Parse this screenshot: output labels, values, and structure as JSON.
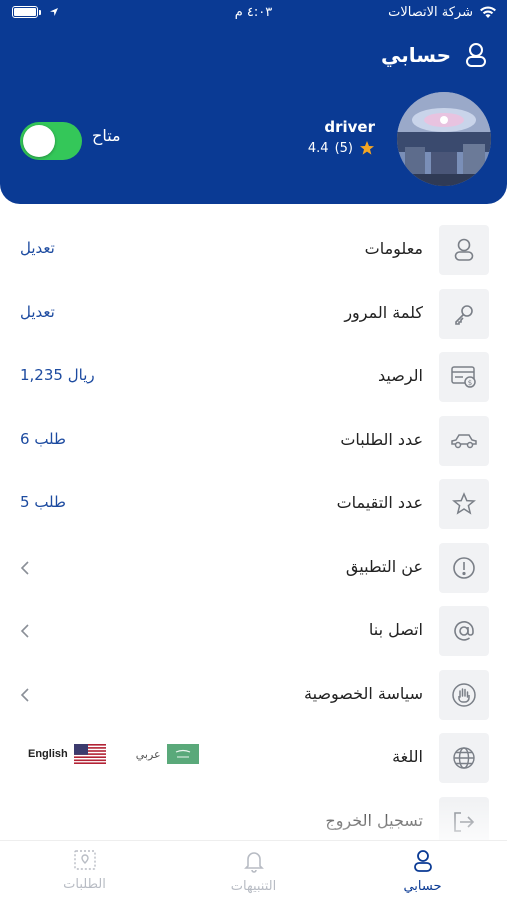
{
  "status_bar": {
    "carrier": "شركة الاتصالات",
    "time": "٤:٠٣ م"
  },
  "header": {
    "title": "حسابي",
    "driver_name": "driver",
    "rating": "4.4",
    "rating_count": "(5)",
    "availability_label": "متاح",
    "availability_on": true,
    "colors": {
      "brand": "#0a3a94",
      "toggle_on": "#34c759",
      "star": "#f5a623"
    }
  },
  "menu": {
    "info": {
      "label": "معلومات",
      "action": "تعديل",
      "icon": "user-icon"
    },
    "password": {
      "label": "كلمة المرور",
      "action": "تعديل",
      "icon": "key-icon"
    },
    "balance": {
      "label": "الرصيد",
      "value": "1,235 ريال",
      "icon": "wallet-icon"
    },
    "orders": {
      "label": "عدد الطلبات",
      "value": "6 طلب",
      "icon": "car-icon"
    },
    "ratings": {
      "label": "عدد التقيمات",
      "value": "5 طلب",
      "icon": "star-icon"
    },
    "about": {
      "label": "عن التطبيق",
      "icon": "info-icon"
    },
    "contact": {
      "label": "اتصل بنا",
      "icon": "at-icon"
    },
    "privacy": {
      "label": "سياسة الخصوصية",
      "icon": "hand-icon"
    },
    "language": {
      "label": "اللغة",
      "icon": "globe-icon",
      "option_ar": "عربي",
      "option_en": "English"
    },
    "logout": {
      "label": "تسجيل الخروج",
      "icon": "logout-icon"
    }
  },
  "tabbar": {
    "account": "حسابي",
    "notifications": "التنبيهات",
    "orders": "الطلبات"
  }
}
